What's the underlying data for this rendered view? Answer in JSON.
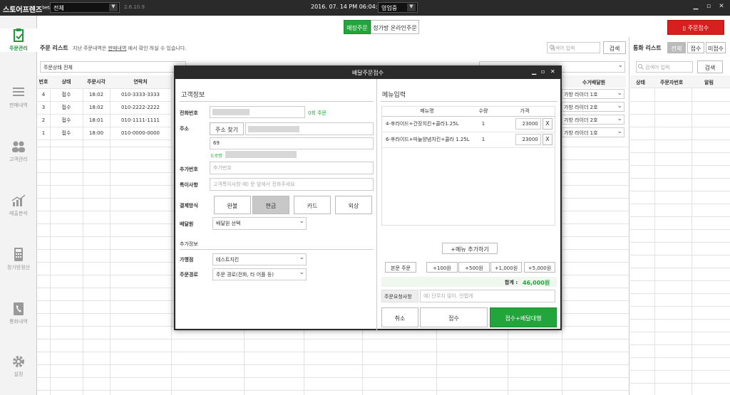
{
  "app": {
    "logo": "스토어프렌즈",
    "beta": "beta",
    "store_select": "전체",
    "version": "2.6.10.9",
    "clock": "2016. 07. 14 PM 06:04:16",
    "status_select": "영업중"
  },
  "sidebar": {
    "items": [
      {
        "label": "주문관리"
      },
      {
        "label": "판매내역"
      },
      {
        "label": "고객관리"
      },
      {
        "label": "매출분석"
      },
      {
        "label": "정가방정산"
      },
      {
        "label": "통화내역"
      },
      {
        "label": "설정"
      }
    ]
  },
  "header": {
    "tab_store": "매장주문",
    "tab_online": "정가방 온라인주문",
    "order_button": "▯ 주문접수"
  },
  "orders": {
    "title": "주문 리스트",
    "hint_pre": "지난 주문내역은",
    "hint_link": "판매내역",
    "hint_post": "에서 확인 하실 수 있습니다.",
    "search_placeholder": "검색어 입력",
    "search_button": "검색",
    "filter_status": "주문상태 전체",
    "columns": [
      "번호",
      "상태",
      "주문시각",
      "연락처",
      "",
      "수거배달원"
    ],
    "rows": [
      {
        "no": "4",
        "status": "접수",
        "time": "18:02",
        "phone": "010-3333-3333",
        "rider": "가방 라이더 1호"
      },
      {
        "no": "3",
        "status": "접수",
        "time": "18:02",
        "phone": "010-2222-2222",
        "rider": "가방 라이더 2호"
      },
      {
        "no": "2",
        "status": "접수",
        "time": "18:01",
        "phone": "010-1111-1111",
        "rider": "가방 라이더 2호"
      },
      {
        "no": "1",
        "status": "접수",
        "time": "18:00",
        "phone": "010-0000-0000",
        "rider": "가방 라이더 1호"
      }
    ]
  },
  "calls": {
    "title": "통화 리스트",
    "tabs": [
      "전체",
      "접수",
      "미접수"
    ],
    "search_placeholder": "검색어 입력",
    "search_button": "검색",
    "columns": [
      "상태",
      "주문자번호",
      "알림"
    ]
  },
  "modal": {
    "title": "배달주문접수",
    "customer": {
      "section": "고객정보",
      "phone_label": "전화번호",
      "order_count": "0회 주문",
      "addr_label": "주소",
      "addr_button": "주소 찾기",
      "addr_detail": "69",
      "road_tag": "도로명",
      "extra_label": "추가번호",
      "extra_placeholder": "추가번호",
      "note_label": "특이사항",
      "note_placeholder": "고객특이사항 예) 문 앞에서 전화주세요",
      "pay_label": "결제방식",
      "pay_options": [
        "완불",
        "현금",
        "카드",
        "외상"
      ],
      "rider_label": "배달원",
      "rider_select": "배달원 선택",
      "addl_section": "추가정보",
      "shop_label": "가맹점",
      "shop_select": "테스트지킨",
      "route_label": "주문경로",
      "route_select": "주문 경로(전화, 타 어플 등)"
    },
    "menu": {
      "section": "메뉴입력",
      "columns": [
        "메뉴명",
        "수량",
        "가격"
      ],
      "items": [
        {
          "name": "4-후라이드+간장치킨+콜라1.25L",
          "qty": "1",
          "price": "23000",
          "x": "X"
        },
        {
          "name": "6-후라이드+마늘양념치킨+콜라 1.25L",
          "qty": "1",
          "price": "23000",
          "x": "X"
        }
      ],
      "add_button": "+메뉴 추가하기",
      "quick": [
        "본문 주문",
        "+100원",
        "+500원",
        "+1,000원",
        "+5,000원"
      ],
      "total_label": "합계 :",
      "total_value": "46,000원",
      "request_label": "주문요청사항",
      "request_placeholder": "예) 단무지 많이. 안맵게",
      "cancel": "취소",
      "accept": "접수",
      "accept_delivery": "접수+배달대행"
    }
  }
}
